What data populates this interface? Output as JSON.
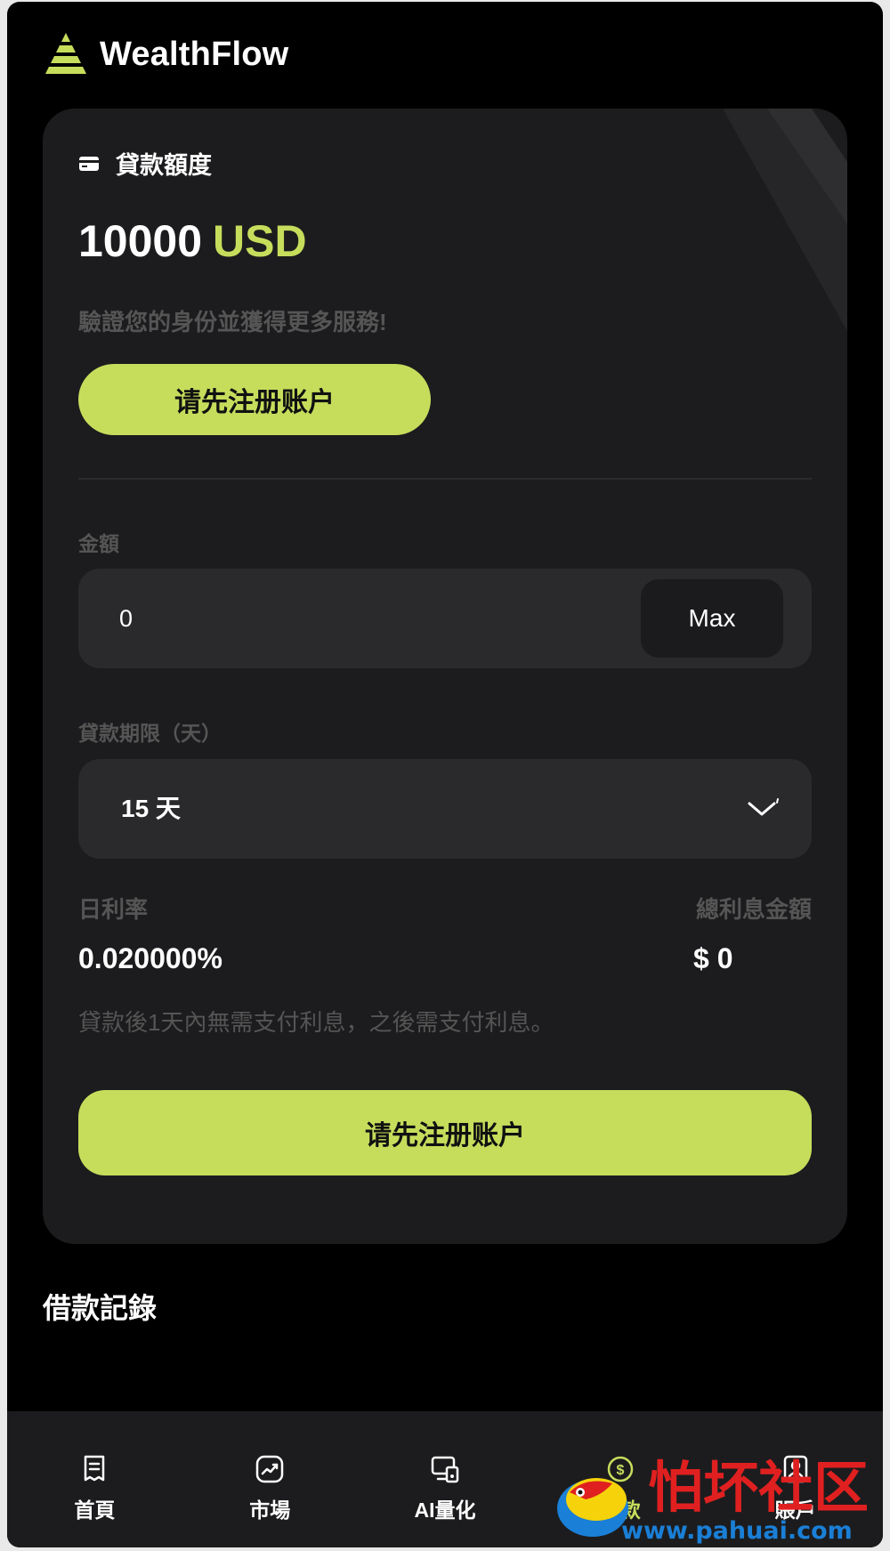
{
  "brand": {
    "name": "WealthFlow",
    "accent_color": "#c6dd5c"
  },
  "loan_card": {
    "title": "貸款額度",
    "amount": "10000",
    "currency": "USD",
    "verify_text": "驗證您的身份並獲得更多服務!",
    "register_label": "请先注册账户",
    "amount_field": {
      "label": "金額",
      "value": "0",
      "max_label": "Max"
    },
    "term_field": {
      "label": "貸款期限（天）",
      "selected": "15 天"
    },
    "daily_rate": {
      "label": "日利率",
      "value": "0.020000%"
    },
    "total_interest": {
      "label": "總利息金額",
      "value": "$ 0"
    },
    "note": "貸款後1天內無需支付利息，之後需支付利息。",
    "submit_label": "请先注册账户"
  },
  "records": {
    "title": "借款記錄"
  },
  "bottom_nav": [
    {
      "label": "首頁",
      "icon": "home-doc-icon"
    },
    {
      "label": "市場",
      "icon": "market-chart-icon"
    },
    {
      "label": "AI量化",
      "icon": "ai-quant-icon"
    },
    {
      "label": "貸款",
      "icon": "loan-icon",
      "active": true
    },
    {
      "label": "賬戶",
      "icon": "account-icon"
    }
  ],
  "watermark": {
    "text": "怕坏社区",
    "url": "www.pahuai.com"
  }
}
